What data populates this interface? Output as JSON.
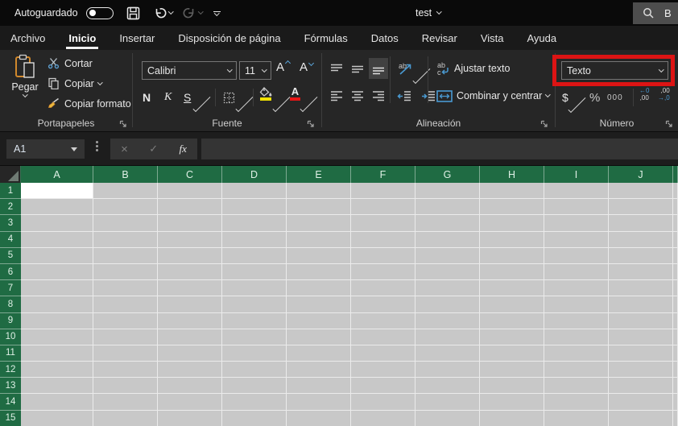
{
  "titlebar": {
    "autosave": "Autoguardado",
    "title": "test",
    "search": "B"
  },
  "tabs": [
    {
      "label": "Archivo",
      "active": false
    },
    {
      "label": "Inicio",
      "active": true
    },
    {
      "label": "Insertar",
      "active": false
    },
    {
      "label": "Disposición de página",
      "active": false
    },
    {
      "label": "Fórmulas",
      "active": false
    },
    {
      "label": "Datos",
      "active": false
    },
    {
      "label": "Revisar",
      "active": false
    },
    {
      "label": "Vista",
      "active": false
    },
    {
      "label": "Ayuda",
      "active": false
    }
  ],
  "ribbon": {
    "clipboard": {
      "label": "Portapapeles",
      "paste": "Pegar",
      "cut": "Cortar",
      "copy": "Copiar",
      "format_painter": "Copiar formato"
    },
    "font": {
      "label": "Fuente",
      "name": "Calibri",
      "size": "11",
      "bold": "N",
      "italic": "K",
      "underline": "S",
      "grow": "A",
      "shrink": "A"
    },
    "alignment": {
      "label": "Alineación",
      "wrap": "Ajustar texto",
      "merge": "Combinar y centrar",
      "orientation_glyph": "ab",
      "wrap_glyph_top": "ab",
      "wrap_glyph_bottom": "c"
    },
    "number": {
      "label": "Número",
      "format": "Texto",
      "currency": "$",
      "percent": "%",
      "thousands": "000",
      "inc_dec_top": "←0",
      "inc_dec_bottom": ",00",
      "dec_dec_top": ",00",
      "dec_dec_bottom": "→,0",
      "highlight_color": "#dd1414"
    }
  },
  "formula_bar": {
    "cell_ref": "A1",
    "cancel": "×",
    "enter": "✓",
    "fx": "fx"
  },
  "grid": {
    "columns": [
      "A",
      "B",
      "C",
      "D",
      "E",
      "F",
      "G",
      "H",
      "I",
      "J"
    ],
    "rows": [
      "1",
      "2",
      "3",
      "4",
      "5",
      "6",
      "7",
      "8",
      "9",
      "10",
      "11",
      "12",
      "13",
      "14",
      "15"
    ],
    "active_cell": "A1"
  }
}
